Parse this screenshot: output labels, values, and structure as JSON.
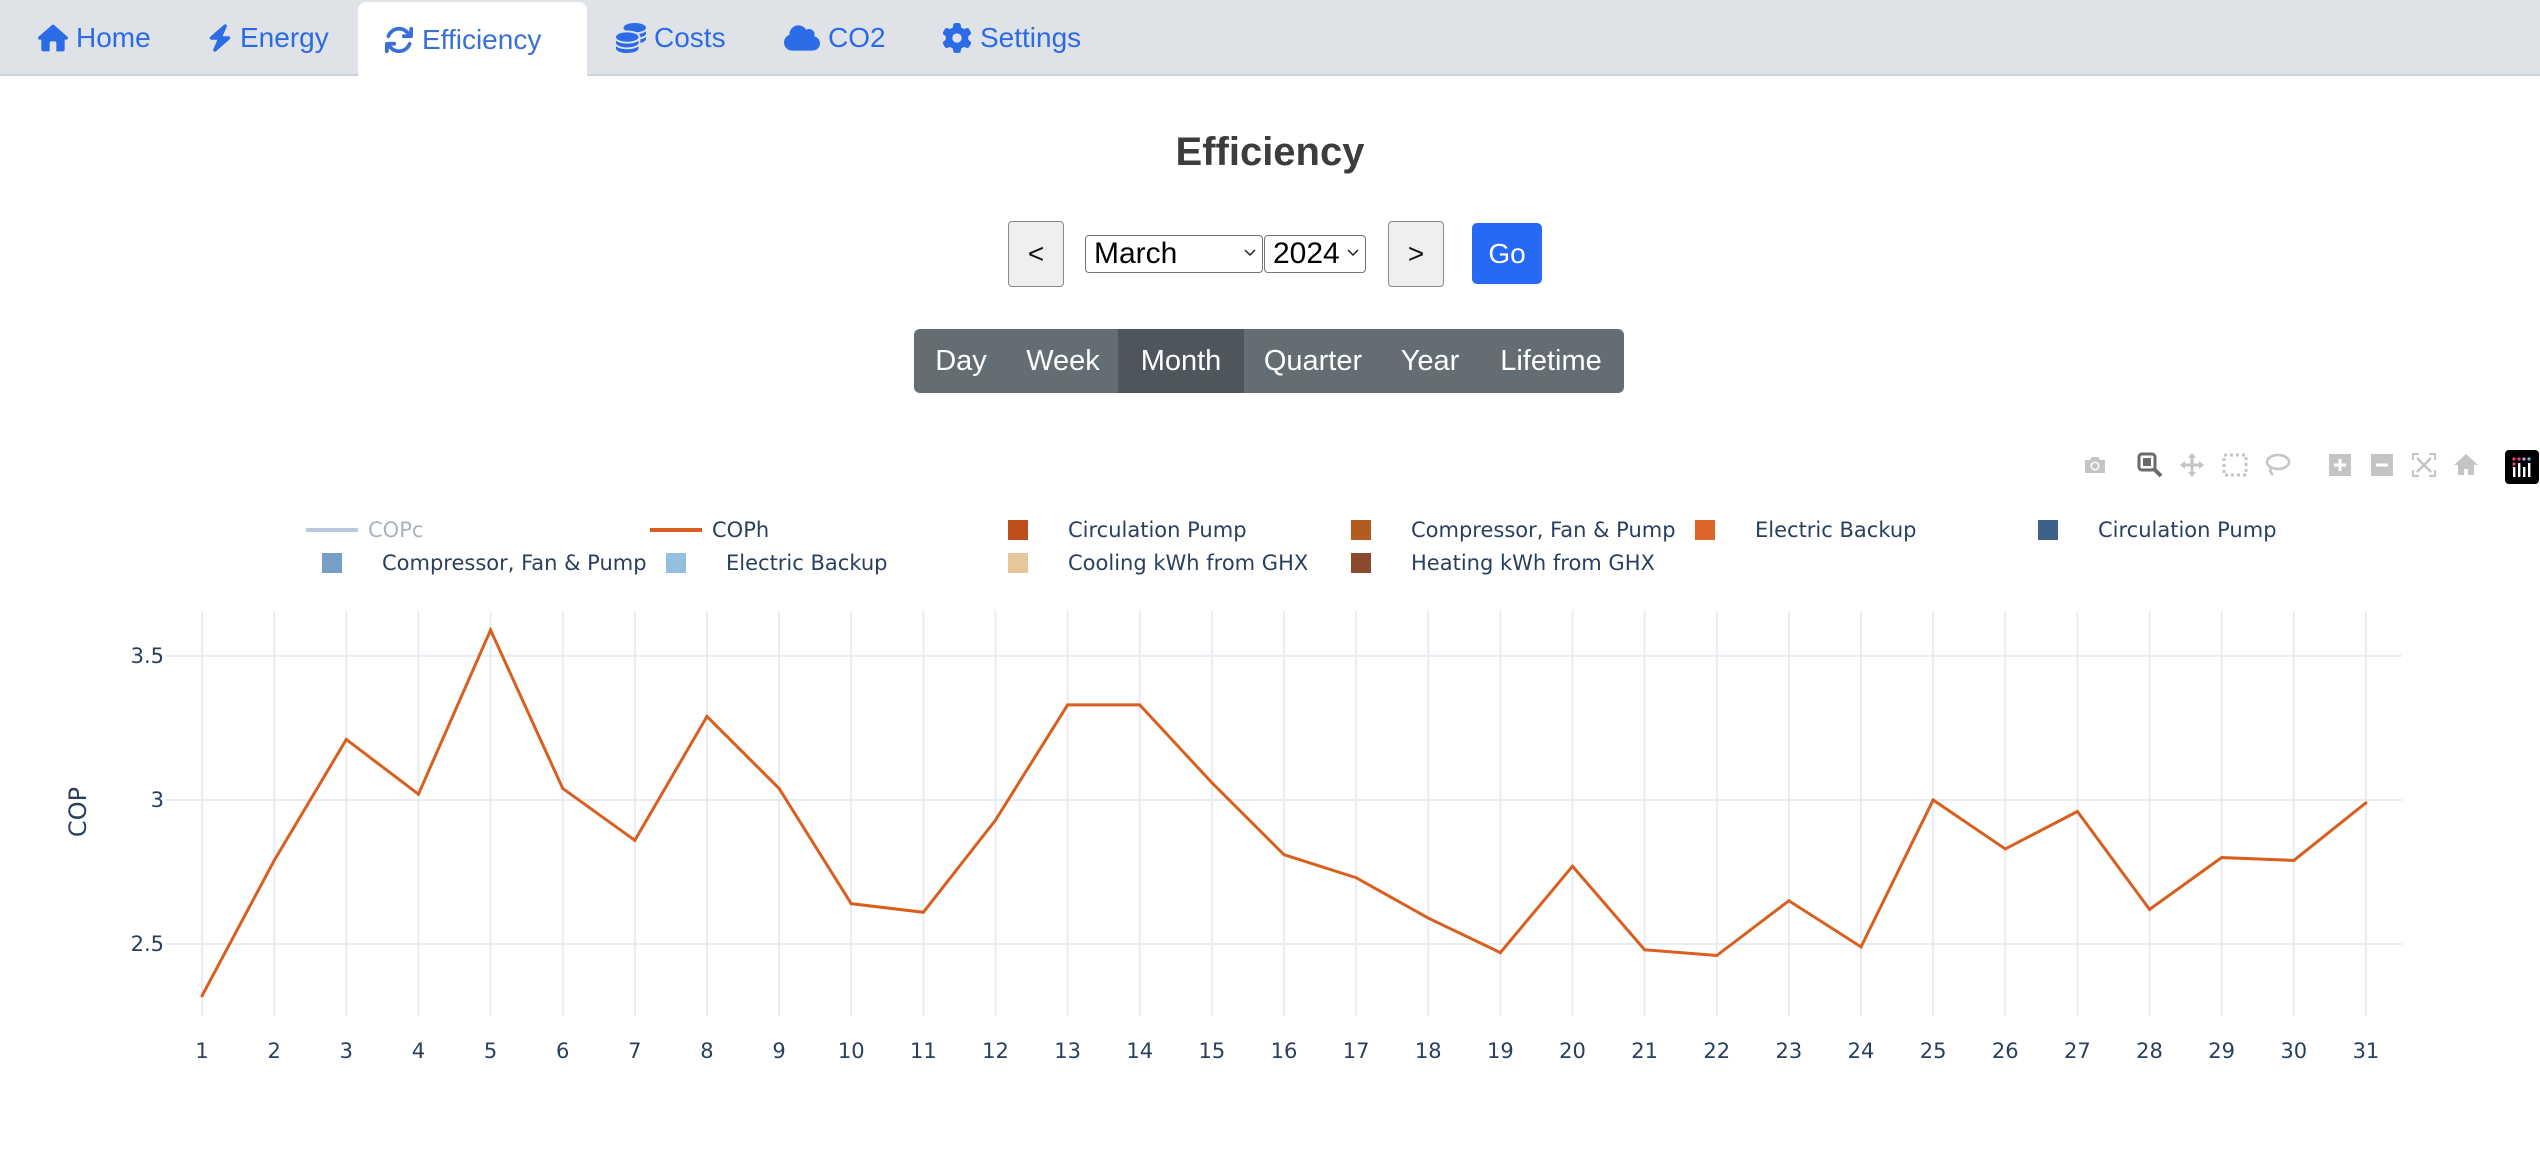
{
  "nav": {
    "tabs": [
      {
        "label": "Home",
        "icon": "home-icon",
        "active": false
      },
      {
        "label": "Energy",
        "icon": "bolt-icon",
        "active": false
      },
      {
        "label": "Efficiency",
        "icon": "refresh-icon",
        "active": true
      },
      {
        "label": "Costs",
        "icon": "coins-icon",
        "active": false
      },
      {
        "label": "CO2",
        "icon": "cloud-icon",
        "active": false
      },
      {
        "label": "Settings",
        "icon": "gear-icon",
        "active": false
      }
    ]
  },
  "page": {
    "title": "Efficiency"
  },
  "date_controls": {
    "prev_label": "<",
    "next_label": ">",
    "month_selected": "March",
    "year_selected": "2024",
    "go_label": "Go"
  },
  "period": {
    "options": [
      "Day",
      "Week",
      "Month",
      "Quarter",
      "Year",
      "Lifetime"
    ],
    "active": "Month"
  },
  "modebar": {
    "buttons": [
      "camera-icon",
      "zoom-icon",
      "pan-icon",
      "box-select-icon",
      "lasso-icon",
      "zoom-in-icon",
      "zoom-out-icon",
      "autoscale-icon",
      "reset-axes-icon",
      "plotly-logo-icon"
    ],
    "active": "zoom-icon"
  },
  "colors": {
    "accent": "#2569f5",
    "nav_link": "#2b6be6",
    "coph_line": "#d95f1e",
    "copc_line": "#b8c9de"
  },
  "chart_data": {
    "type": "line",
    "title": "",
    "xlabel": "",
    "ylabel": "COP",
    "xlim": [
      0.5,
      31.5
    ],
    "ylim": [
      2.25,
      3.656
    ],
    "y_ticks": [
      2.5,
      3,
      3.5
    ],
    "y_tick_labels": [
      "2.5",
      "3",
      "3.5"
    ],
    "grid": true,
    "legend_position": "top",
    "legend": [
      {
        "name": "COPc",
        "kind": "line",
        "color": "#b8c9de",
        "hidden": true
      },
      {
        "name": "COPh",
        "kind": "line",
        "color": "#d95f1e",
        "hidden": false
      },
      {
        "name": "Circulation Pump",
        "kind": "box",
        "color": "#bd4f1c"
      },
      {
        "name": "Compressor, Fan & Pump",
        "kind": "box",
        "color": "#b35c22"
      },
      {
        "name": "Electric Backup",
        "kind": "box",
        "color": "#dc6424"
      },
      {
        "name": "Circulation Pump",
        "kind": "box",
        "color": "#3f6189"
      },
      {
        "name": "Compressor, Fan & Pump",
        "kind": "box",
        "color": "#779ec6"
      },
      {
        "name": "Electric Backup",
        "kind": "box",
        "color": "#94c0e0"
      },
      {
        "name": "Cooling kWh from GHX",
        "kind": "box",
        "color": "#e6c79c"
      },
      {
        "name": "Heating kWh from GHX",
        "kind": "box",
        "color": "#8c4a2c"
      }
    ],
    "x": [
      1,
      2,
      3,
      4,
      5,
      6,
      7,
      8,
      9,
      10,
      11,
      12,
      13,
      14,
      15,
      16,
      17,
      18,
      19,
      20,
      21,
      22,
      23,
      24,
      25,
      26,
      27,
      28,
      29,
      30,
      31
    ],
    "series": [
      {
        "name": "COPh",
        "values": [
          2.32,
          2.79,
          3.21,
          3.02,
          3.59,
          3.04,
          2.86,
          3.29,
          3.04,
          2.64,
          2.61,
          2.93,
          3.33,
          3.33,
          3.06,
          2.81,
          2.73,
          2.59,
          2.47,
          2.77,
          2.48,
          2.46,
          2.65,
          2.49,
          3.0,
          2.83,
          2.96,
          2.62,
          2.8,
          2.79,
          2.99
        ]
      }
    ]
  }
}
